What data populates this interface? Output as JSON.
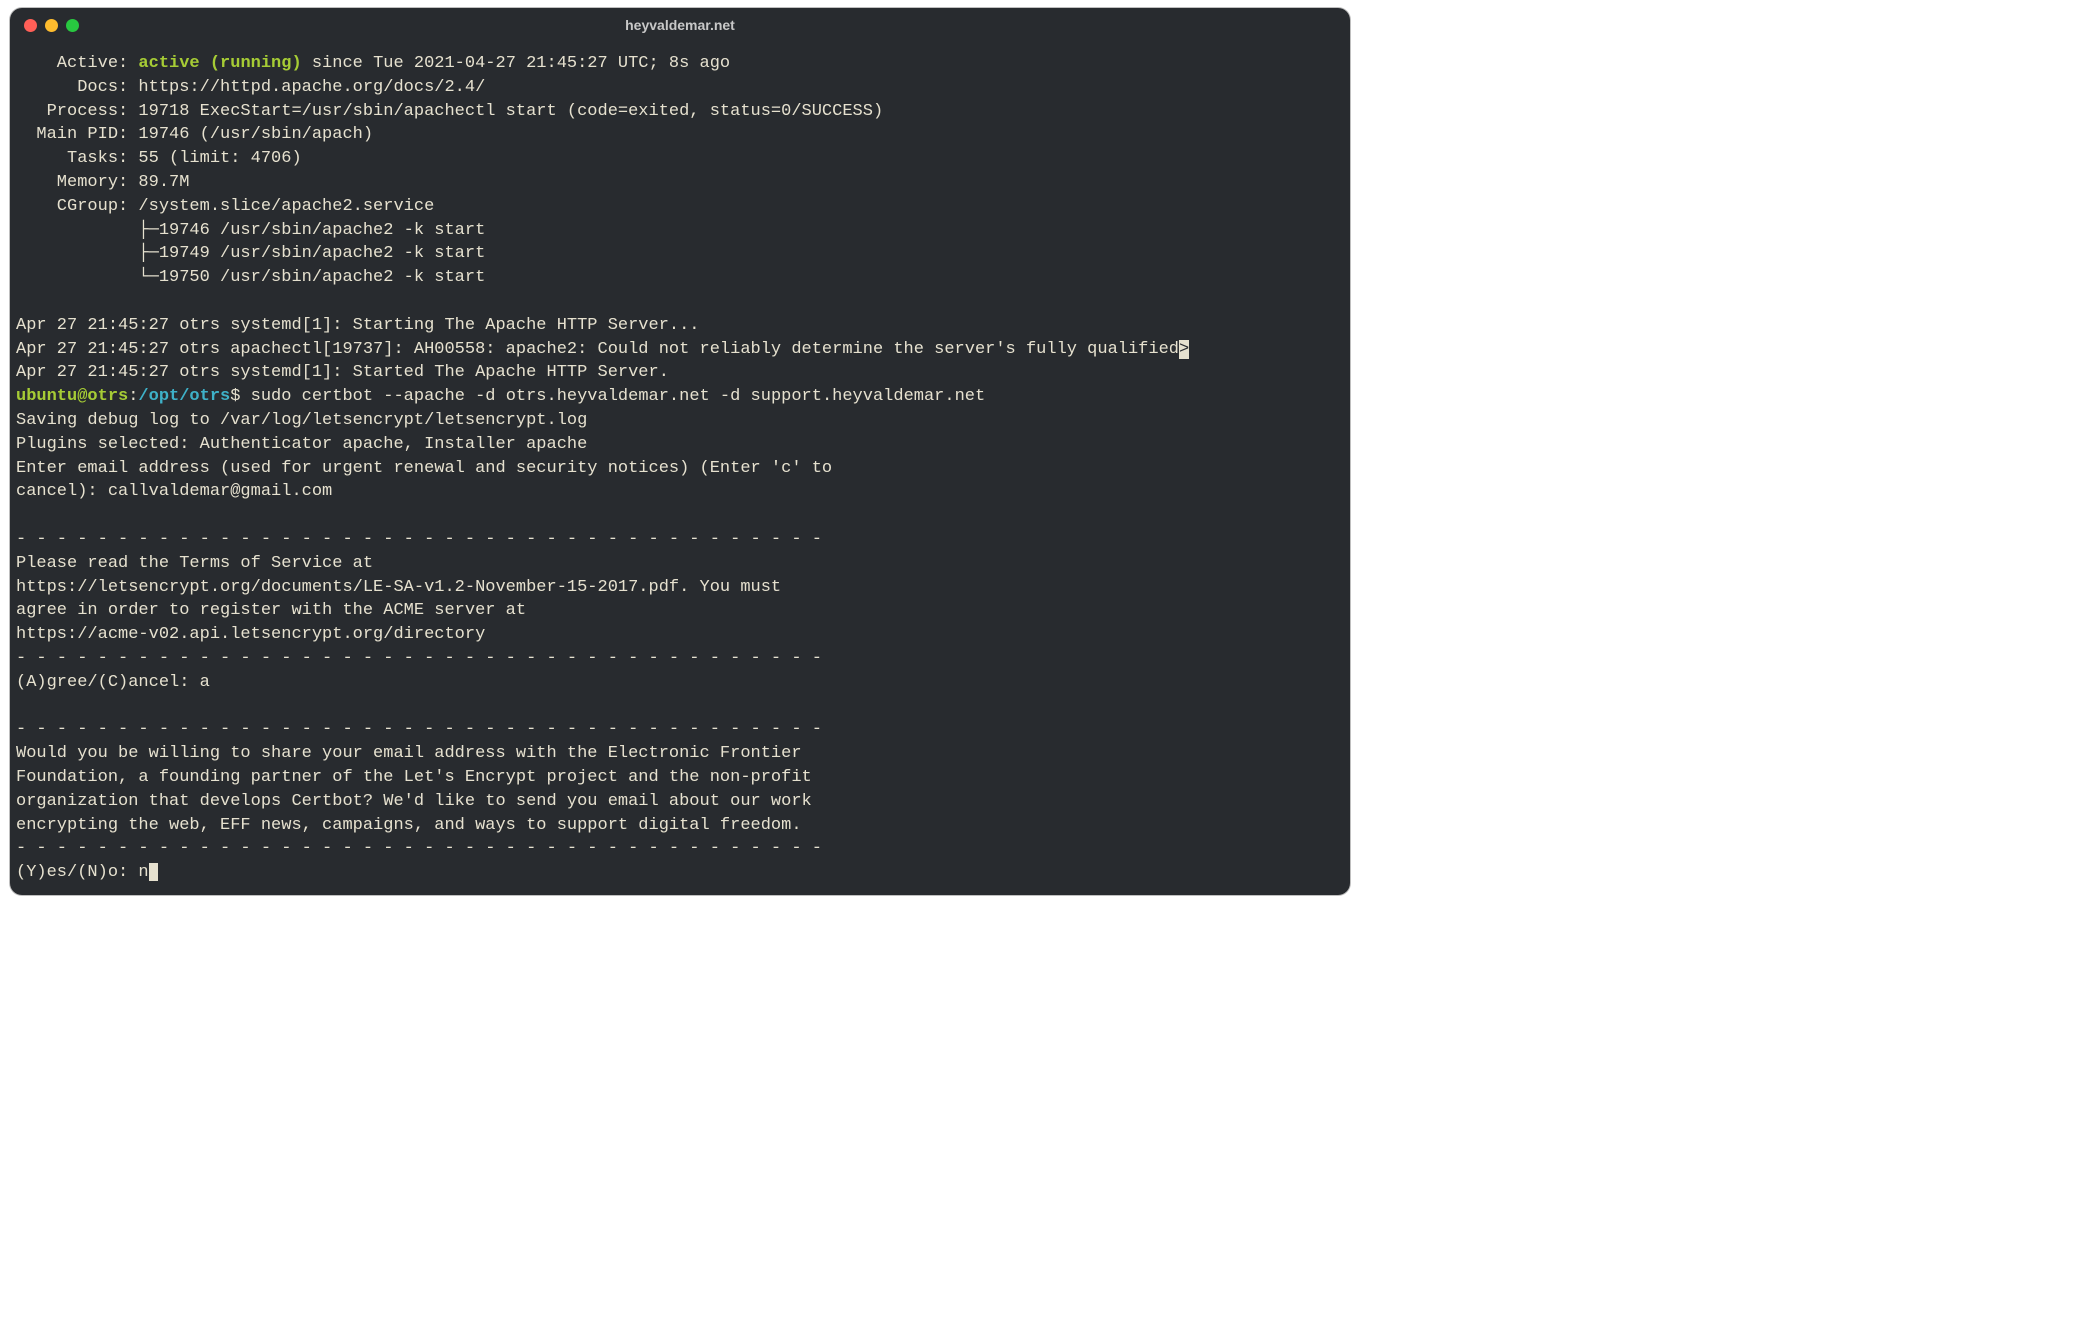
{
  "window": {
    "title": "heyvaldemar.net"
  },
  "status": {
    "activeLabel": "    Active: ",
    "activeValue": "active (running)",
    "activeSince": " since Tue 2021-04-27 21:45:27 UTC; 8s ago",
    "docs": "      Docs: https://httpd.apache.org/docs/2.4/",
    "process": "   Process: 19718 ExecStart=/usr/sbin/apachectl start (code=exited, status=0/SUCCESS)",
    "mainpid": "  Main PID: 19746 (/usr/sbin/apach)",
    "tasks": "     Tasks: 55 (limit: 4706)",
    "memory": "    Memory: 89.7M",
    "cgroup": "    CGroup: /system.slice/apache2.service",
    "cg1": "            ├─19746 /usr/sbin/apache2 -k start",
    "cg2": "            ├─19749 /usr/sbin/apache2 -k start",
    "cg3": "            └─19750 /usr/sbin/apache2 -k start"
  },
  "logs": {
    "l1": "Apr 27 21:45:27 otrs systemd[1]: Starting The Apache HTTP Server...",
    "l2a": "Apr 27 21:45:27 otrs apachectl[19737]: AH00558: apache2: Could not reliably determine the server's fully qualified",
    "l2b": ">",
    "l3": "Apr 27 21:45:27 otrs systemd[1]: Started The Apache HTTP Server."
  },
  "prompt": {
    "userhost": "ubuntu@otrs",
    "colon": ":",
    "path": "/opt/otrs",
    "dollar": "$ ",
    "cmd": "sudo certbot --apache -d otrs.heyvaldemar.net -d support.heyvaldemar.net"
  },
  "certbot": {
    "o1": "Saving debug log to /var/log/letsencrypt/letsencrypt.log",
    "o2": "Plugins selected: Authenticator apache, Installer apache",
    "o3": "Enter email address (used for urgent renewal and security notices) (Enter 'c' to",
    "o4": "cancel): callvaldemar@gmail.com",
    "dash": "- - - - - - - - - - - - - - - - - - - - - - - - - - - - - - - - - - - - - - - -",
    "tos1": "Please read the Terms of Service at",
    "tos2": "https://letsencrypt.org/documents/LE-SA-v1.2-November-15-2017.pdf. You must",
    "tos3": "agree in order to register with the ACME server at",
    "tos4": "https://acme-v02.api.letsencrypt.org/directory",
    "agree": "(A)gree/(C)ancel: a",
    "eff1": "Would you be willing to share your email address with the Electronic Frontier",
    "eff2": "Foundation, a founding partner of the Let's Encrypt project and the non-profit",
    "eff3": "organization that develops Certbot? We'd like to send you email about our work",
    "eff4": "encrypting the web, EFF news, campaigns, and ways to support digital freedom.",
    "yesno": "(Y)es/(N)o: n"
  }
}
